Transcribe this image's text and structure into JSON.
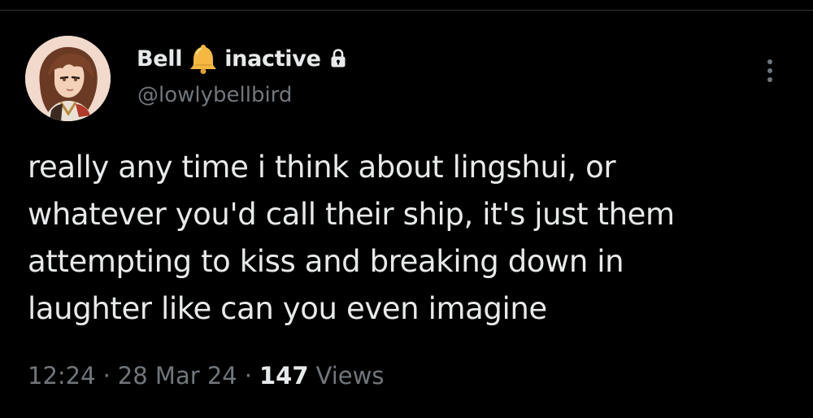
{
  "author": {
    "name_prefix": "Bell",
    "name_emoji_icon": "bell-icon",
    "name_suffix": "inactive",
    "protected_icon": "lock-icon",
    "handle": "@lowlybellbird",
    "avatar_icon": "avatar-illustration"
  },
  "more_menu_icon": "more-vertical-icon",
  "tweet": {
    "lines": [
      "really any time i think about lingshui, or",
      "whatever you'd call their ship, it's just them",
      "attempting to kiss and breaking down in",
      "laughter like can you even imagine"
    ]
  },
  "meta": {
    "time": "12:24",
    "separator": "·",
    "date": "28 Mar 24",
    "views_count": "147",
    "views_label": "Views"
  },
  "colors": {
    "background": "#000000",
    "primary_text": "#e7e9ea",
    "secondary_text": "#71767b",
    "divider": "#2f3336",
    "bell": "#f5b942"
  }
}
